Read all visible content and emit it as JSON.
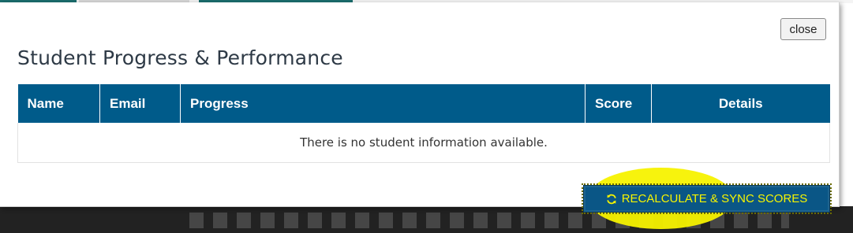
{
  "modal": {
    "title": "Student Progress & Performance",
    "close_label": "close"
  },
  "table": {
    "columns": [
      "Name",
      "Email",
      "Progress",
      "Score",
      "Details"
    ],
    "empty_message": "There is no student information available."
  },
  "actions": {
    "sync_label": "RECALCULATE & SYNC SCORES",
    "sync_icon": "refresh-icon"
  },
  "colors": {
    "header_bg": "#005b8a",
    "button_bg": "#0a5686",
    "button_text": "#f6f400",
    "highlight": "#f7f200"
  }
}
